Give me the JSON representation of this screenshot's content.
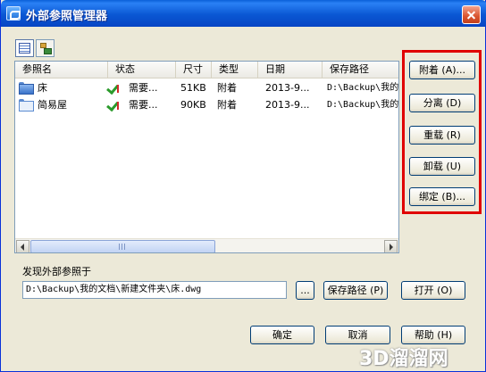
{
  "window": {
    "title": "外部参照管理器"
  },
  "toolbar": {
    "list_view_icon": "list-view-icon",
    "tree_view_icon": "tree-view-icon"
  },
  "table": {
    "columns": [
      "参照名",
      "状态",
      "尺寸",
      "类型",
      "日期",
      "保存路径"
    ],
    "rows": [
      {
        "name": "床",
        "status": "需要...",
        "size": "51KB",
        "type": "附着",
        "date": "2013-9...",
        "path": "D:\\Backup\\我的",
        "icon": "folder-filled-icon"
      },
      {
        "name": "简易屋",
        "status": "需要...",
        "size": "90KB",
        "type": "附着",
        "date": "2013-9...",
        "path": "D:\\Backup\\我的",
        "icon": "folder-outline-icon"
      }
    ]
  },
  "side_buttons": {
    "attach": "附着 (A)...",
    "detach": "分离 (D)",
    "reload": "重载 (R)",
    "unload": "卸载 (U)",
    "bind": "绑定 (B)..."
  },
  "found_in": {
    "label": "发现外部参照于",
    "value": "D:\\Backup\\我的文档\\新建文件夹\\床.dwg",
    "browse": "...",
    "save_path": "保存路径 (P)",
    "open": "打开 (O)"
  },
  "footer": {
    "ok": "确定",
    "cancel": "取消",
    "help": "帮助 (H)"
  },
  "watermark": "3D溜溜网",
  "colors": {
    "titlebar": "#0a57d3",
    "highlight": "#e00000",
    "dialog_bg": "#ece9d8"
  }
}
